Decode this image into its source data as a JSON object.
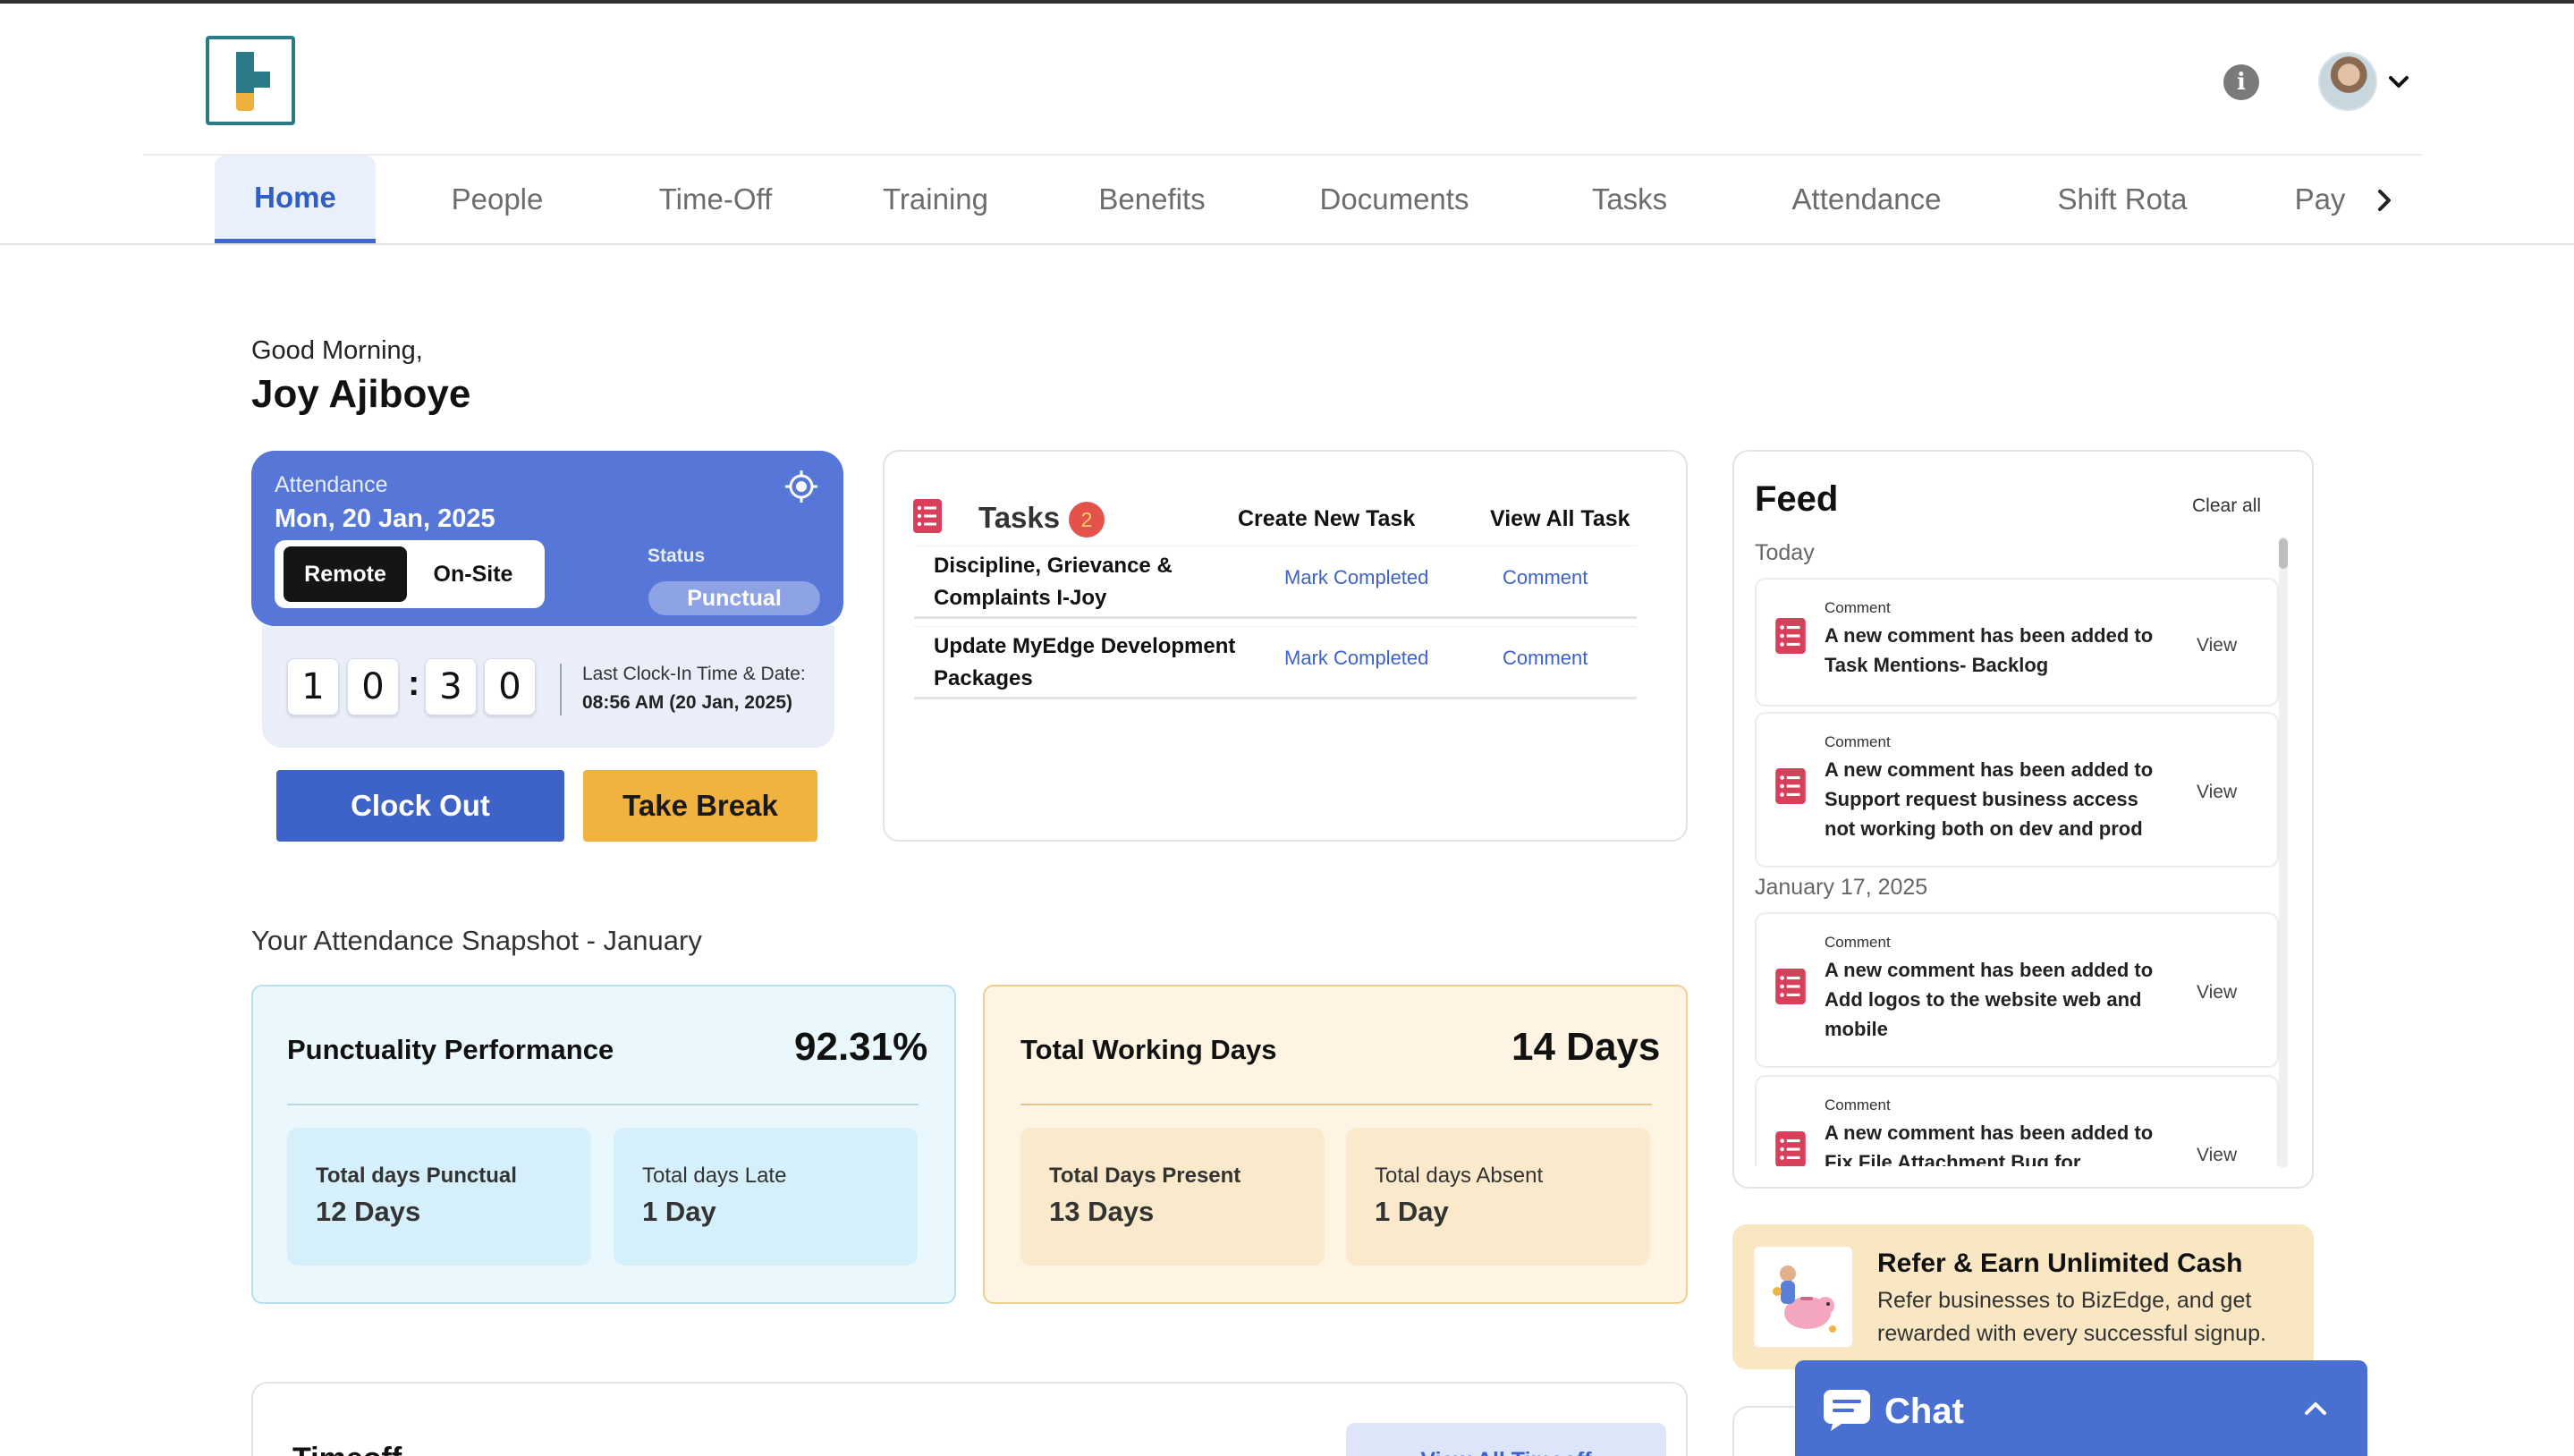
{
  "header": {
    "logo": "bizedge-logo",
    "info_icon": "info-icon",
    "avatar": "user-avatar"
  },
  "tabs": [
    {
      "label": "Home",
      "active": true
    },
    {
      "label": "People"
    },
    {
      "label": "Time-Off"
    },
    {
      "label": "Training"
    },
    {
      "label": "Benefits"
    },
    {
      "label": "Documents"
    },
    {
      "label": "Tasks"
    },
    {
      "label": "Attendance"
    },
    {
      "label": "Shift Rota"
    },
    {
      "label": "Pay"
    }
  ],
  "greeting": {
    "salutation": "Good Morning,",
    "name": "Joy Ajiboye"
  },
  "attendance": {
    "label": "Attendance",
    "date": "Mon, 20 Jan, 2025",
    "mode_remote": "Remote",
    "mode_onsite": "On-Site",
    "selected_mode": "Remote",
    "status_label": "Status",
    "status_value": "Punctual",
    "timer": {
      "d1": "1",
      "d2": "0",
      "d3": "3",
      "d4": "0",
      "separator": ":"
    },
    "last_clock_label": "Last Clock-In Time & Date:",
    "last_clock_value": "08:56 AM (20 Jan, 2025)",
    "clock_out_label": "Clock Out",
    "take_break_label": "Take Break",
    "colors": {
      "card": "#5676d8",
      "clock_out": "#3d62c8",
      "take_break": "#f2b23f"
    }
  },
  "tasks": {
    "title": "Tasks",
    "count": "2",
    "create_label": "Create New Task",
    "view_all_label": "View All Task",
    "items": [
      {
        "name": "Discipline, Grievance & Complaints I-Joy",
        "mark": "Mark Completed",
        "comment": "Comment"
      },
      {
        "name": "Update MyEdge Development Packages",
        "mark": "Mark Completed",
        "comment": "Comment"
      }
    ]
  },
  "feed": {
    "title": "Feed",
    "clear_label": "Clear all",
    "groups": [
      {
        "date": "Today",
        "items": [
          {
            "kind": "Comment",
            "text": "A new comment has been added to Task Mentions- Backlog",
            "view": "View"
          },
          {
            "kind": "Comment",
            "text": "A new comment has been added to Support request business access not working both on dev and prod",
            "view": "View"
          }
        ]
      },
      {
        "date": "January 17, 2025",
        "items": [
          {
            "kind": "Comment",
            "text": "A new comment has been added to Add logos to the website web and mobile",
            "view": "View"
          },
          {
            "kind": "Comment",
            "text": "A new comment has been added to Fix File Attachment Bug for",
            "view": "View"
          }
        ]
      }
    ]
  },
  "snapshot": {
    "title": "Your Attendance Snapshot - January",
    "punctuality": {
      "heading": "Punctuality Performance",
      "value": "92.31%",
      "punctual_label": "Total days Punctual",
      "punctual_value": "12 Days",
      "late_label": "Total days Late",
      "late_value": "1 Day"
    },
    "working": {
      "heading": "Total Working Days",
      "value": "14 Days",
      "present_label": "Total Days Present",
      "present_value": "13 Days",
      "absent_label": "Total days Absent",
      "absent_value": "1 Day"
    }
  },
  "refer": {
    "title": "Refer & Earn Unlimited Cash",
    "text": "Refer businesses to BizEdge, and get rewarded with every successful signup."
  },
  "timeoff": {
    "title": "Timeoff",
    "view_all_label": "View All Timeoff"
  },
  "chat": {
    "label": "Chat"
  }
}
